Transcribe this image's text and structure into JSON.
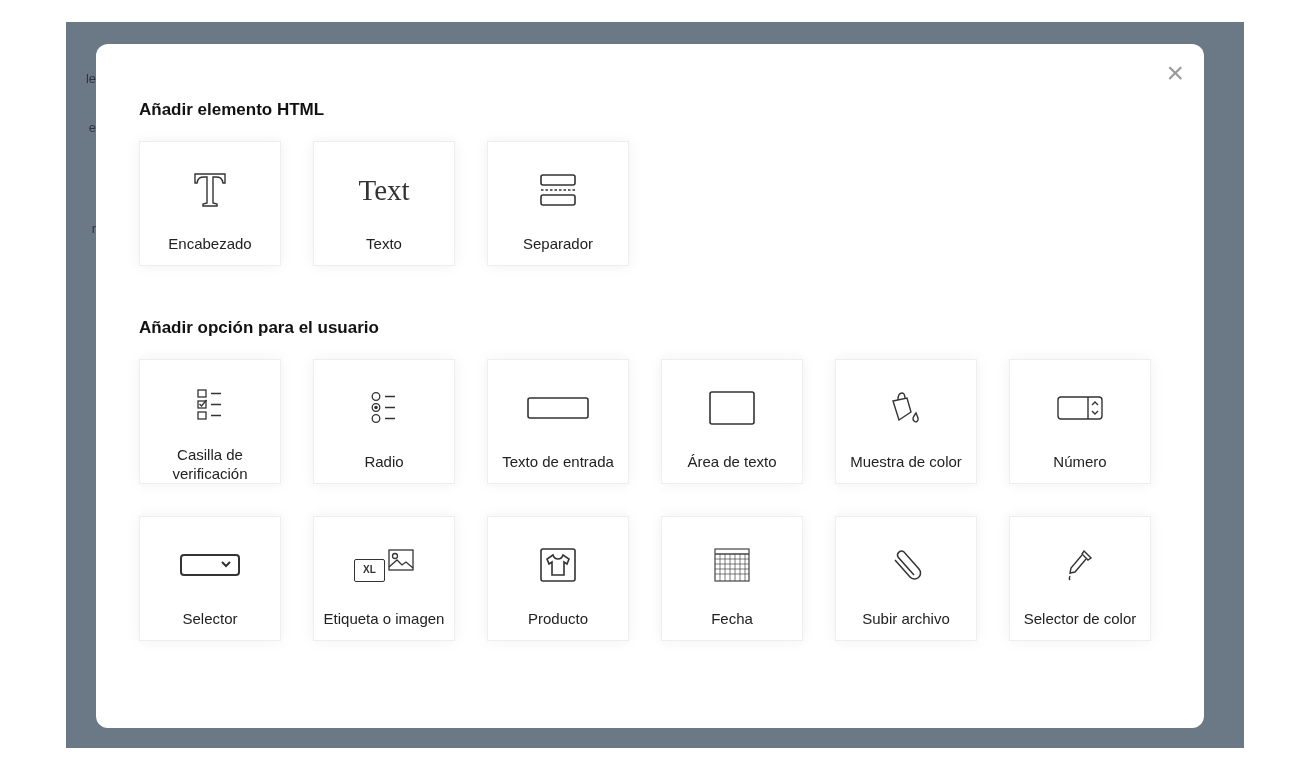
{
  "background_text": [
    "le",
    "e",
    "r"
  ],
  "dialog": {
    "close_label": "×",
    "sections": [
      {
        "title": "Añadir elemento HTML",
        "items": [
          {
            "kind": "heading",
            "label": "Encabezado"
          },
          {
            "kind": "text",
            "label": "Texto",
            "icon_text": "Text"
          },
          {
            "kind": "divider",
            "label": "Separador"
          }
        ]
      },
      {
        "title": "Añadir opción para el usuario",
        "items": [
          {
            "kind": "checkbox",
            "label": "Casilla de verificación"
          },
          {
            "kind": "radio",
            "label": "Radio"
          },
          {
            "kind": "input",
            "label": "Texto de entrada"
          },
          {
            "kind": "textarea",
            "label": "Área de texto"
          },
          {
            "kind": "swatch",
            "label": "Muestra de color"
          },
          {
            "kind": "number",
            "label": "Número"
          },
          {
            "kind": "select",
            "label": "Selector"
          },
          {
            "kind": "label_image",
            "label": "Etiqueta o imagen",
            "icon_text": "XL"
          },
          {
            "kind": "product",
            "label": "Producto"
          },
          {
            "kind": "date",
            "label": "Fecha"
          },
          {
            "kind": "upload",
            "label": "Subir archivo"
          },
          {
            "kind": "picker",
            "label": "Selector de color"
          }
        ]
      }
    ]
  }
}
